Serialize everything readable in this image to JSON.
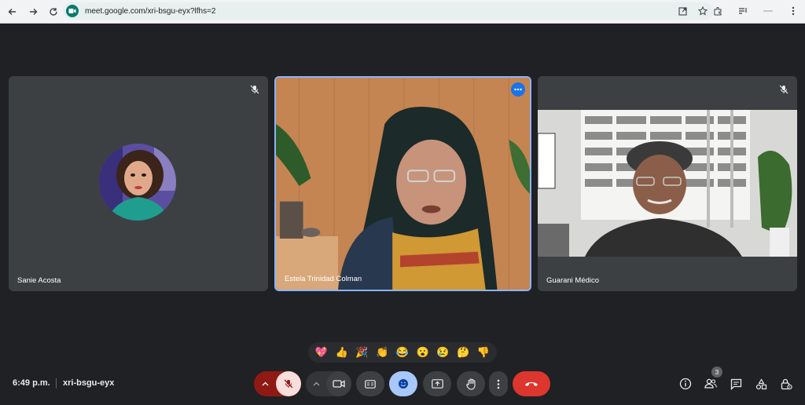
{
  "browser": {
    "url": "meet.google.com/xri-bsgu-eyx?lfhs=2",
    "toolbar_icons": [
      "back-icon",
      "forward-icon",
      "reload-icon"
    ],
    "omnibox_icons": [
      "open-in-new-icon",
      "bookmark-star-icon"
    ],
    "right_icons": [
      "extensions-icon",
      "media-control-icon",
      "profile-icon",
      "menu-icon"
    ]
  },
  "tiles": [
    {
      "name": "Sanie Acosta",
      "muted": true,
      "kind": "avatar"
    },
    {
      "name": "Estela Trinidad Colman",
      "muted": false,
      "kind": "video",
      "active_speaker": true
    },
    {
      "name": "Guarani Médico",
      "muted": true,
      "kind": "video"
    }
  ],
  "reactions": [
    "💖",
    "👍",
    "🎉",
    "👏",
    "😂",
    "😮",
    "😢",
    "🤔",
    "👎"
  ],
  "footer": {
    "time": "6:49 p.m.",
    "meeting_code": "xri-bsgu-eyx",
    "participant_count": "3"
  },
  "colors": {
    "background": "#202124",
    "tile": "#3c4043",
    "active_border": "#8ab4f8",
    "mic_off": "#8e1a13",
    "leave": "#dc362e",
    "reactions_active": "#a8c7fa"
  }
}
